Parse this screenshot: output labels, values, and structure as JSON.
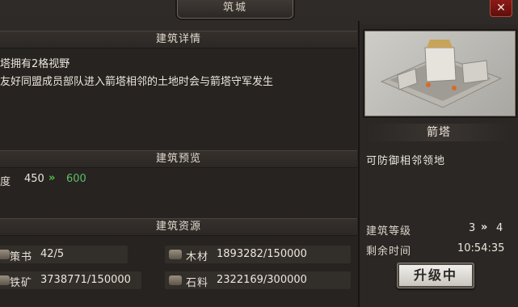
{
  "window": {
    "title": "筑城"
  },
  "sections": {
    "details": {
      "header": "建筑详情",
      "line1": "塔拥有2格视野",
      "line2": "友好同盟成员部队进入箭塔相邻的土地时会与箭塔守军发生"
    },
    "preview": {
      "header": "建筑预览",
      "label": "度",
      "current": "450",
      "next": "600"
    },
    "resources": {
      "header": "建筑资源",
      "items": [
        {
          "label": "策书",
          "value": "42/5",
          "icon": "book-icon"
        },
        {
          "label": "木材",
          "value": "1893282/150000",
          "icon": "wood-icon"
        },
        {
          "label": "铁矿",
          "value": "3738771/150000",
          "icon": "iron-ore-icon"
        },
        {
          "label": "石料",
          "value": "2322169/300000",
          "icon": "stone-icon"
        }
      ]
    }
  },
  "building": {
    "name": "箭塔",
    "description": "可防御相邻领地",
    "level_label": "建筑等级",
    "level_current": "3",
    "level_next": "4",
    "time_label": "剩余时间",
    "time_value": "10:54:35",
    "upgrade_label": "升级中"
  },
  "colors": {
    "arrow": "#4fc04a",
    "close": "#8c1b17"
  }
}
